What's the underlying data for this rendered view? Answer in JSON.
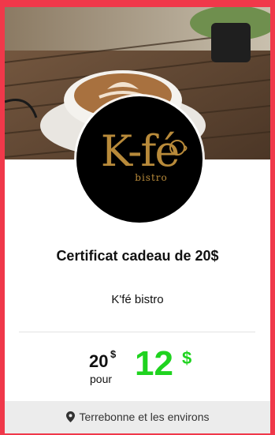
{
  "offer": {
    "title": "Certificat cadeau de 20$",
    "merchant": "K'fé bistro",
    "logo": {
      "text": "K-fé",
      "subtext": "bistro"
    },
    "price": {
      "original_value": "20",
      "original_currency": "$",
      "connector": "pour",
      "sale_value": "12",
      "sale_currency": "$"
    },
    "location": {
      "icon": "map-pin-icon",
      "text": "Terrebonne et les environs"
    }
  },
  "colors": {
    "frame": "#f0384a",
    "sale_price": "#1fd31f",
    "logo_gold": "#b88a3a",
    "footer_bg": "#ececec"
  }
}
